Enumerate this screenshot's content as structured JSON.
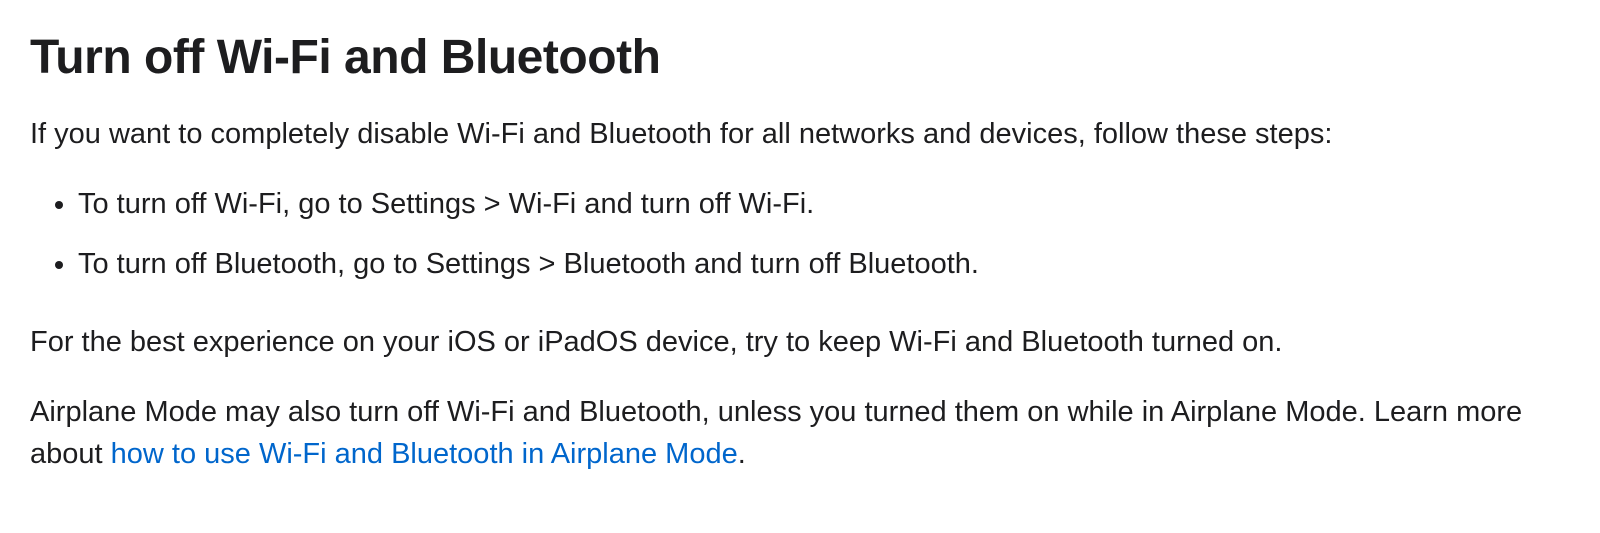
{
  "heading": "Turn off Wi-Fi and Bluetooth",
  "intro": "If you want to completely disable Wi-Fi and Bluetooth for all networks and devices, follow these steps:",
  "steps": [
    "To turn off Wi-Fi, go to Settings > Wi-Fi and turn off Wi-Fi.",
    "To turn off Bluetooth, go to Settings > Bluetooth and turn off Bluetooth."
  ],
  "note": "For the best experience on your iOS or iPadOS device, try to keep Wi-Fi and Bluetooth turned on.",
  "airplane": {
    "pre": "Airplane Mode may also turn off Wi-Fi and Bluetooth, unless you turned them on while in Airplane Mode. Learn more about ",
    "link_text": "how to use Wi-Fi and Bluetooth in Airplane Mode",
    "post": "."
  }
}
